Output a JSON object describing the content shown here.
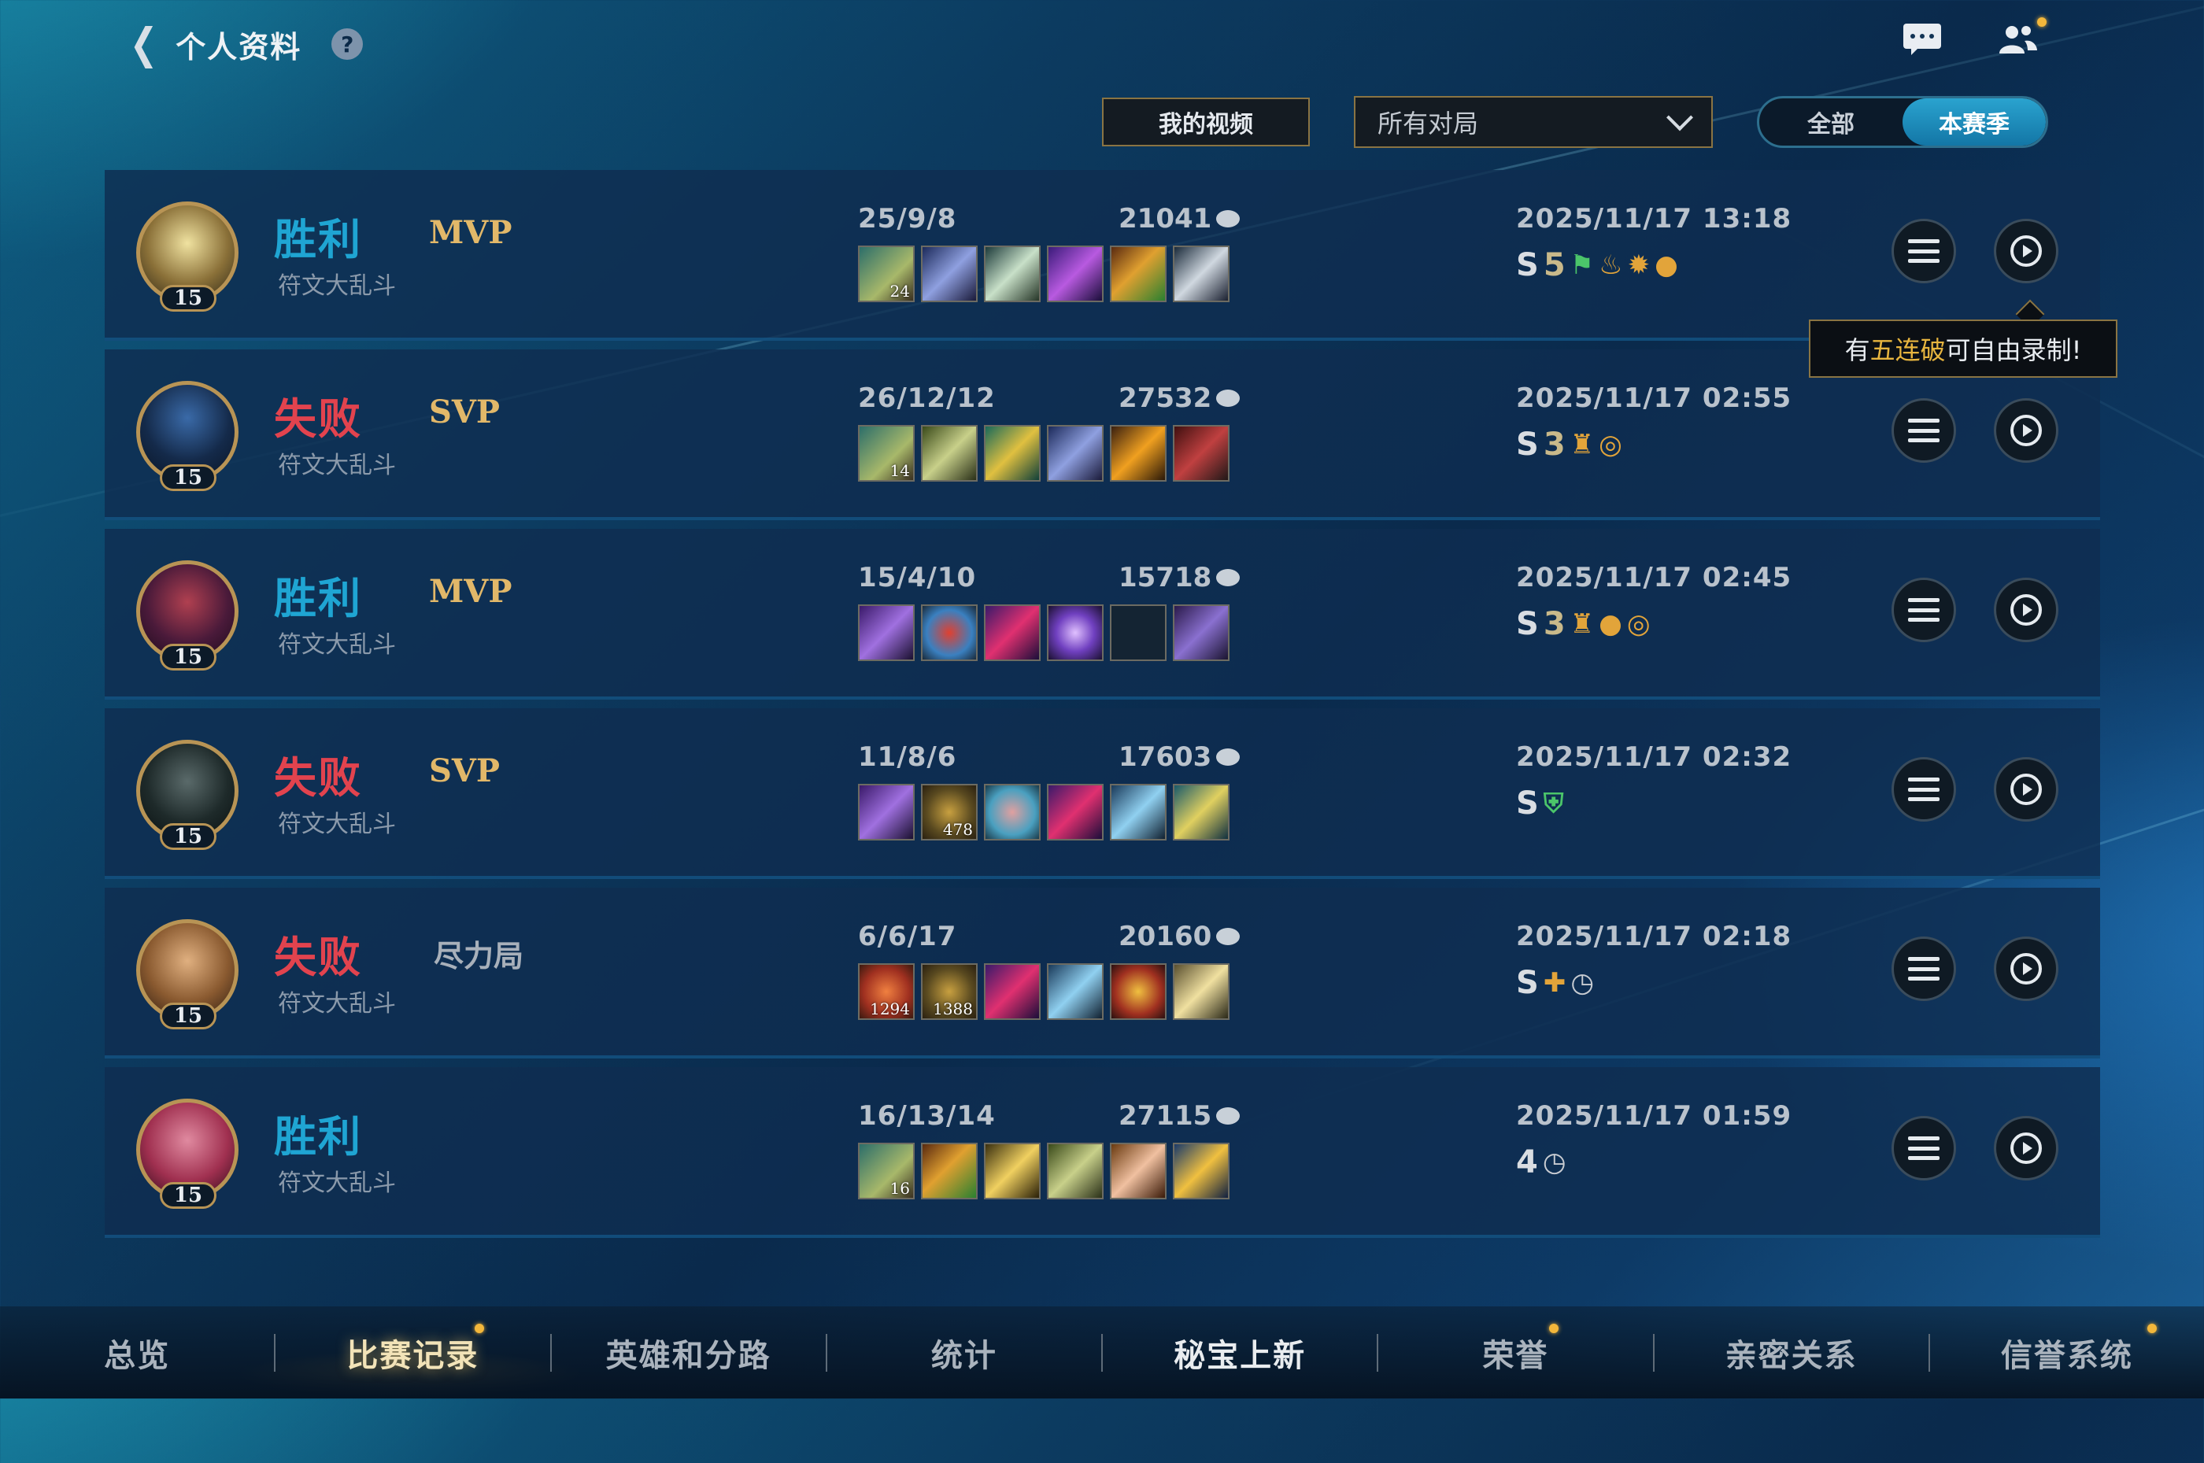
{
  "header": {
    "title": "个人资料",
    "help": "?"
  },
  "controls": {
    "video_button": "我的视频",
    "match_filter": "所有对局",
    "season_toggle": [
      "全部",
      "本赛季"
    ]
  },
  "matches": [
    {
      "result": "胜利",
      "outcome": "win",
      "mode": "符文大乱斗",
      "badge": "MVP",
      "level": "15",
      "kda": "25/9/8",
      "gold": "21041",
      "date": "2025/11/17 13:18",
      "tags": [
        "S",
        "5"
      ],
      "item_stacks": [
        "24",
        "",
        "",
        "",
        "",
        ""
      ]
    },
    {
      "result": "失败",
      "outcome": "loss",
      "mode": "符文大乱斗",
      "badge": "SVP",
      "level": "15",
      "kda": "26/12/12",
      "gold": "27532",
      "date": "2025/11/17 02:55",
      "tags": [
        "S",
        "3"
      ],
      "item_stacks": [
        "14",
        "",
        "",
        "",
        "",
        ""
      ]
    },
    {
      "result": "胜利",
      "outcome": "win",
      "mode": "符文大乱斗",
      "badge": "MVP",
      "level": "15",
      "kda": "15/4/10",
      "gold": "15718",
      "date": "2025/11/17 02:45",
      "tags": [
        "S",
        "3"
      ],
      "item_stacks": [
        "",
        "",
        "",
        "",
        "",
        ""
      ]
    },
    {
      "result": "失败",
      "outcome": "loss",
      "mode": "符文大乱斗",
      "badge": "SVP",
      "level": "15",
      "kda": "11/8/6",
      "gold": "17603",
      "date": "2025/11/17 02:32",
      "tags": [
        "S",
        ""
      ],
      "item_stacks": [
        "",
        "478",
        "",
        "",
        "",
        ""
      ]
    },
    {
      "result": "失败",
      "outcome": "loss",
      "mode": "符文大乱斗",
      "badge": "尽力局",
      "level": "15",
      "kda": "6/6/17",
      "gold": "20160",
      "date": "2025/11/17 02:18",
      "tags": [
        "S",
        ""
      ],
      "item_stacks": [
        "1294",
        "1388",
        "",
        "",
        "",
        ""
      ]
    },
    {
      "result": "胜利",
      "outcome": "win",
      "mode": "符文大乱斗",
      "badge": "",
      "level": "15",
      "kda": "16/13/14",
      "gold": "27115",
      "date": "2025/11/17 01:59",
      "tags": [
        "4",
        ""
      ],
      "item_stacks": [
        "16",
        "",
        "",
        "",
        "",
        ""
      ]
    }
  ],
  "tooltip": {
    "prefix": "有",
    "highlight": "五连破",
    "suffix": "可自由录制!"
  },
  "bottom_nav": [
    "总览",
    "比赛记录",
    "英雄和分路",
    "统计",
    "秘宝上新",
    "荣誉",
    "亲密关系",
    "信誉系统"
  ],
  "icons": {
    "back": "chevron-left-icon",
    "help": "help-icon",
    "chat": "chat-icon",
    "friends": "friends-icon",
    "detail": "list-icon",
    "replay": "replay-icon",
    "gold": "coin-icon"
  },
  "colors": {
    "win": "#1fa5d3",
    "loss": "#e2434e",
    "gold_accent": "#e7b53f",
    "frame": "#8a7443",
    "active_toggle": "#1f8fbd"
  }
}
